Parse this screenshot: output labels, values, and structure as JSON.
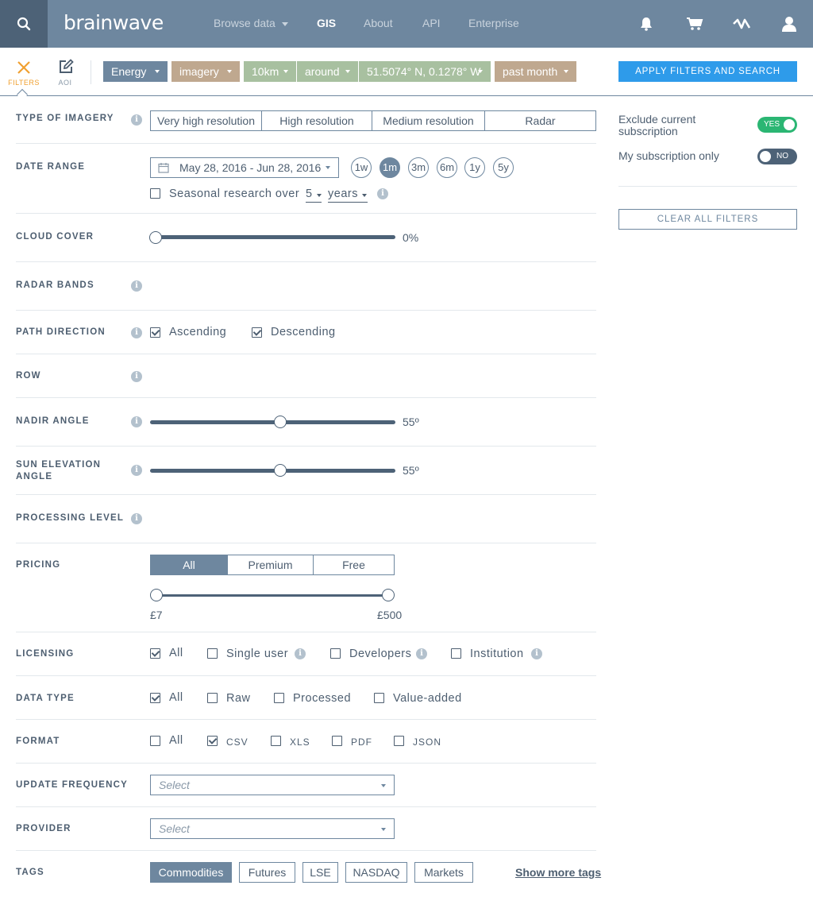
{
  "nav": {
    "logo": "brainwave",
    "links": [
      "Browse data",
      "GIS",
      "About",
      "API",
      "Enterprise"
    ],
    "active_link": "GIS"
  },
  "filterbar": {
    "tabs": [
      {
        "label": "FILTERS",
        "icon": "close-icon",
        "color": "#f0a030"
      },
      {
        "label": "AOI",
        "icon": "edit-icon",
        "color": "#6e879f"
      }
    ],
    "chips": [
      {
        "label": "Energy",
        "color": "#6e879f"
      },
      {
        "label": "imagery",
        "color": "#bfa88f"
      },
      {
        "label": "10km",
        "color": "#a8c0a0"
      },
      {
        "label": "around",
        "color": "#a8c0a0"
      },
      {
        "label": "51.5074° N, 0.1278° W",
        "color": "#a8c0a0"
      },
      {
        "label": "past month",
        "color": "#bfa88f"
      }
    ],
    "apply_label": "APPLY FILTERS AND SEARCH"
  },
  "form": {
    "type_of_imagery": {
      "label": "TYPE OF IMAGERY",
      "options": [
        "Very high resolution",
        "High resolution",
        "Medium resolution",
        "Radar"
      ]
    },
    "date_range": {
      "label": "DATE RANGE",
      "value": "May 28, 2016 - Jun 28, 2016",
      "quick": [
        "1w",
        "1m",
        "3m",
        "6m",
        "1y",
        "5y"
      ],
      "quick_selected": "1m",
      "seasonal_label": "Seasonal research over",
      "seasonal_count": "5",
      "seasonal_unit": "years",
      "seasonal_checked": false
    },
    "cloud_cover": {
      "label": "CLOUD COVER",
      "value": "0%",
      "level": 0
    },
    "radar_bands": {
      "label": "RADAR BANDS"
    },
    "path_direction": {
      "label": "PATH DIRECTION",
      "options": [
        {
          "label": "Ascending",
          "checked": true
        },
        {
          "label": "Descending",
          "checked": true
        }
      ]
    },
    "row": {
      "label": "ROW"
    },
    "nadir_angle": {
      "label": "NADIR ANGLE",
      "value": "55º",
      "level": 0.53
    },
    "sun_elevation": {
      "label": "SUN ELEVATION ANGLE",
      "value": "55º",
      "level": 0.53
    },
    "processing_level": {
      "label": "PROCESSING LEVEL"
    },
    "pricing": {
      "label": "PRICING",
      "options": [
        "All",
        "Premium",
        "Free"
      ],
      "selected": "All",
      "min_label": "£7",
      "max_label": "£500"
    },
    "licensing": {
      "label": "LICENSING",
      "options": [
        {
          "label": "All",
          "checked": true
        },
        {
          "label": "Single user",
          "checked": false
        },
        {
          "label": "Developers",
          "checked": false
        },
        {
          "label": "Institution",
          "checked": false
        }
      ]
    },
    "data_type": {
      "label": "DATA TYPE",
      "options": [
        {
          "label": "All",
          "checked": true
        },
        {
          "label": "Raw",
          "checked": false
        },
        {
          "label": "Processed",
          "checked": false
        },
        {
          "label": "Value-added",
          "checked": false
        }
      ]
    },
    "format": {
      "label": "FORMAT",
      "options": [
        {
          "label": "All",
          "checked": false
        },
        {
          "label": "CSV",
          "checked": true
        },
        {
          "label": "XLS",
          "checked": false
        },
        {
          "label": "PDF",
          "checked": false
        },
        {
          "label": "JSON",
          "checked": false
        }
      ]
    },
    "update_frequency": {
      "label": "UPDATE FREQUENCY",
      "placeholder": "Select"
    },
    "provider": {
      "label": "PROVIDER",
      "placeholder": "Select"
    },
    "tags": {
      "label": "TAGS",
      "items": [
        "Commodities",
        "Futures",
        "LSE",
        "NASDAQ",
        "Markets"
      ],
      "selected": "Commodities",
      "more_label": "Show more tags"
    }
  },
  "right_panel": {
    "exclude_label": "Exclude current subscription",
    "exclude_toggle": "YES",
    "my_sub_label": "My subscription only",
    "my_sub_toggle": "NO",
    "clear_label": "CLEAR ALL FILTERS",
    "colors": {
      "yes": "#2bb673",
      "no": "#4d6277"
    }
  }
}
